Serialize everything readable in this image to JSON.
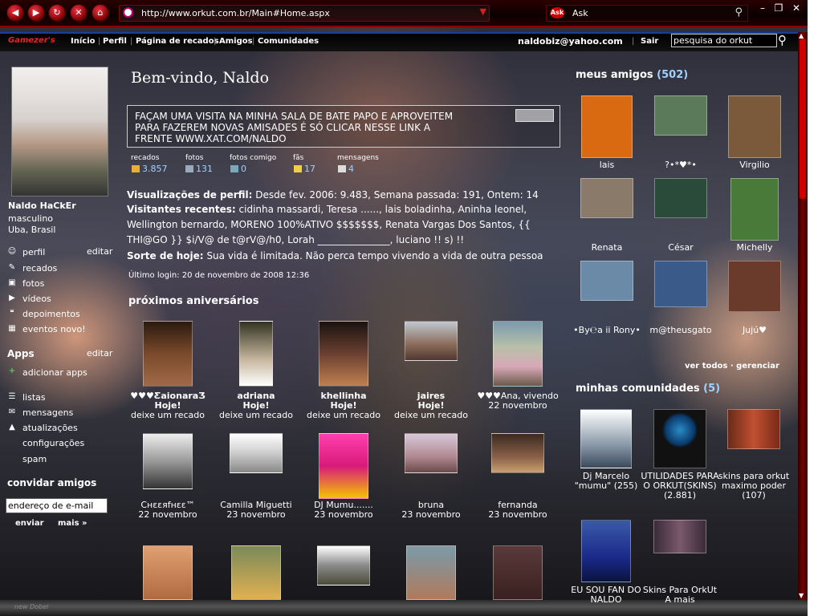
{
  "browser": {
    "url": "http://www.orkut.com.br/Main#Home.aspx",
    "search_engine": "Ask",
    "nav_buttons": [
      "back-icon",
      "forward-icon",
      "refresh-icon",
      "stop-icon",
      "home-icon"
    ]
  },
  "nav": {
    "brand": "Gamezer's",
    "links": [
      "Início",
      "Perfil",
      "Página de recados",
      "Amigos",
      "Comunidades"
    ],
    "user_email": "naldobiz@yahoo.com",
    "logout": "Sair",
    "search_placeholder": "pesquisa do orkut"
  },
  "profile": {
    "name": "Naldo HaCkEr",
    "gender": "masculino",
    "location": "Uba, Brasil",
    "menu": [
      {
        "icon": "person-icon",
        "label": "perfil",
        "edit": "editar"
      },
      {
        "icon": "scrap-icon",
        "label": "recados"
      },
      {
        "icon": "photo-icon",
        "label": "fotos"
      },
      {
        "icon": "video-icon",
        "label": "vídeos"
      },
      {
        "icon": "testimonial-icon",
        "label": "depoimentos"
      },
      {
        "icon": "event-icon",
        "label": "eventos novo!"
      }
    ],
    "apps": {
      "title": "Apps",
      "edit": "editar",
      "add": "adicionar apps"
    },
    "menu2": [
      {
        "icon": "list-icon",
        "label": "listas"
      },
      {
        "icon": "mail-icon",
        "label": "mensagens"
      },
      {
        "icon": "update-icon",
        "label": "atualizações"
      },
      {
        "label": "configurações"
      },
      {
        "label": "spam"
      }
    ],
    "invite": {
      "title": "convidar amigos",
      "placeholder": "endereço de e-mail",
      "send": "enviar",
      "more": "mais »"
    }
  },
  "main": {
    "welcome": "Bem-vindo, Naldo",
    "status": "FAÇAM UMA VISITA NA MINHA SALA DE BATE PAPO E APROVEITEM PARA FAZEREM NOVAS AMISADES É SÓ CLICAR NESSE LINK A FRENTE www.xat.com/Naldo",
    "stats": [
      {
        "label": "recados",
        "value": "3.857",
        "icon": "scrap-icon"
      },
      {
        "label": "fotos",
        "value": "131",
        "icon": "photo-icon"
      },
      {
        "label": "fotos comigo",
        "value": "0",
        "icon": "tag-icon"
      },
      {
        "label": "fãs",
        "value": "17",
        "icon": "star-icon"
      },
      {
        "label": "mensagens",
        "value": "4",
        "icon": "mail-icon"
      }
    ],
    "views_label": "Visualizações de perfil:",
    "views_text": "Desde fev. 2006: 9.483, Semana passada: 191, Ontem: 14",
    "visitors_label": "Visitantes recentes:",
    "visitors_text": "cidinha massardi, Teresa ......, lais boladinha, Aninha leonel, Wellington bernardo, MORENO 100%ATIVO $$$$$$$, Renata Vargas Dos Santos, {{ THI@GO }} $i/V@ de t@rV@/h0, Lorah _______________, luciano !! s) !!",
    "luck_label": "Sorte de hoje:",
    "luck_text": "Sua vida é limitada. Não perca tempo vivendo a vida de outra pessoa",
    "last_login": "Último login: 20 de novembro de 2008 12:36",
    "birthdays_title": "próximos aniversários",
    "birthdays": [
      {
        "name": "♥♥♥ƸaionaraƷ",
        "when": "Hoje!",
        "action": "deixe um recado",
        "bold": true
      },
      {
        "name": "adriana",
        "when": "Hoje!",
        "action": "deixe um recado",
        "bold": true
      },
      {
        "name": "khellinha",
        "when": "Hoje!",
        "action": "deixe um recado",
        "bold": true
      },
      {
        "name": "jaires",
        "when": "Hoje!",
        "action": "deixe um recado",
        "bold": true
      },
      {
        "name": "♥♥♥Ana, vivendo",
        "when": "22 novembro",
        "bold": false
      },
      {
        "name": "Cнεεяfнεε™",
        "when": "22 novembro",
        "bold": false
      },
      {
        "name": "Camilla Miguetti",
        "when": "23 novembro",
        "bold": false
      },
      {
        "name": "DJ Mumu.......",
        "when": "23 novembro",
        "bold": false
      },
      {
        "name": "bruna",
        "when": "23 novembro",
        "bold": false
      },
      {
        "name": "fernanda",
        "when": "23 novembro",
        "bold": false
      }
    ]
  },
  "friends": {
    "title": "meus amigos",
    "count": "(502)",
    "list": [
      {
        "name": "lais",
        "color": "#d96a12"
      },
      {
        "name": "?•*♥*•",
        "color": "#5a7a5a"
      },
      {
        "name": "Virgilio",
        "color": "#7a5a3a"
      },
      {
        "name": "Renata",
        "color": "#8a7a6a"
      },
      {
        "name": "César",
        "color": "#2a4a3a"
      },
      {
        "name": "Michelly",
        "color": "#4a7a3a"
      },
      {
        "name": "•By℮a ii Rony•",
        "color": "#6a8aa8"
      },
      {
        "name": "m@theusgato",
        "color": "#3a5a8a"
      },
      {
        "name": "Jujú♥",
        "color": "#6a3a2a"
      }
    ],
    "see_all": "ver todos · gerenciar"
  },
  "communities": {
    "title": "minhas comunidades",
    "count": "(5)",
    "list": [
      {
        "name": "Dj Marcelo \"mumu\" (255)",
        "color": "#3a4a5a"
      },
      {
        "name": "UTILIDADES PARA O ORKUT(SKINS) (2.881)",
        "color": "#111111"
      },
      {
        "name": "skins para orkut maximo poder (107)",
        "color": "#6a2a1a"
      },
      {
        "name": "EU SOU FAN DO NALDO",
        "color": "#1a2a8a"
      },
      {
        "name": "Skins Para OrkUt A mais",
        "color": "#3a2a3a"
      }
    ]
  },
  "footer": {
    "text": "new Dobel"
  }
}
